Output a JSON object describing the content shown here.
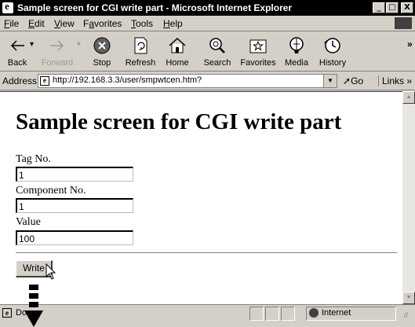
{
  "window": {
    "title": "Sample screen for CGI write part - Microsoft Internet Explorer",
    "controls": [
      "_",
      "□",
      "X"
    ]
  },
  "menu": {
    "items": [
      {
        "label": "File",
        "accel": "F",
        "rest": "ile"
      },
      {
        "label": "Edit",
        "accel": "E",
        "rest": "dit"
      },
      {
        "label": "View",
        "accel": "V",
        "rest": "iew"
      },
      {
        "label": "Favorites",
        "accel": "a",
        "pre": "F",
        "rest": "vorites"
      },
      {
        "label": "Tools",
        "accel": "T",
        "rest": "ools"
      },
      {
        "label": "Help",
        "accel": "H",
        "rest": "elp"
      }
    ]
  },
  "toolbar": {
    "back": "Back",
    "forward": "Forward",
    "stop": "Stop",
    "refresh": "Refresh",
    "home": "Home",
    "search": "Search",
    "favorites": "Favorites",
    "media": "Media",
    "history": "History",
    "overflow": "»"
  },
  "address": {
    "label": "Address",
    "url": "http://192.168.3.3/user/smpwtcen.htm?",
    "go": "Go",
    "links": "Links »"
  },
  "page": {
    "heading": "Sample screen for CGI write part",
    "fields": [
      {
        "label": "Tag No.",
        "value": "1"
      },
      {
        "label": "Component No.",
        "value": "1"
      },
      {
        "label": "Value",
        "value": "100"
      }
    ],
    "write_button": "Write"
  },
  "status": {
    "text": "Done",
    "zone": "Internet"
  },
  "colors": {
    "titlebar": "#000000",
    "chrome": "#d4d0c8"
  }
}
